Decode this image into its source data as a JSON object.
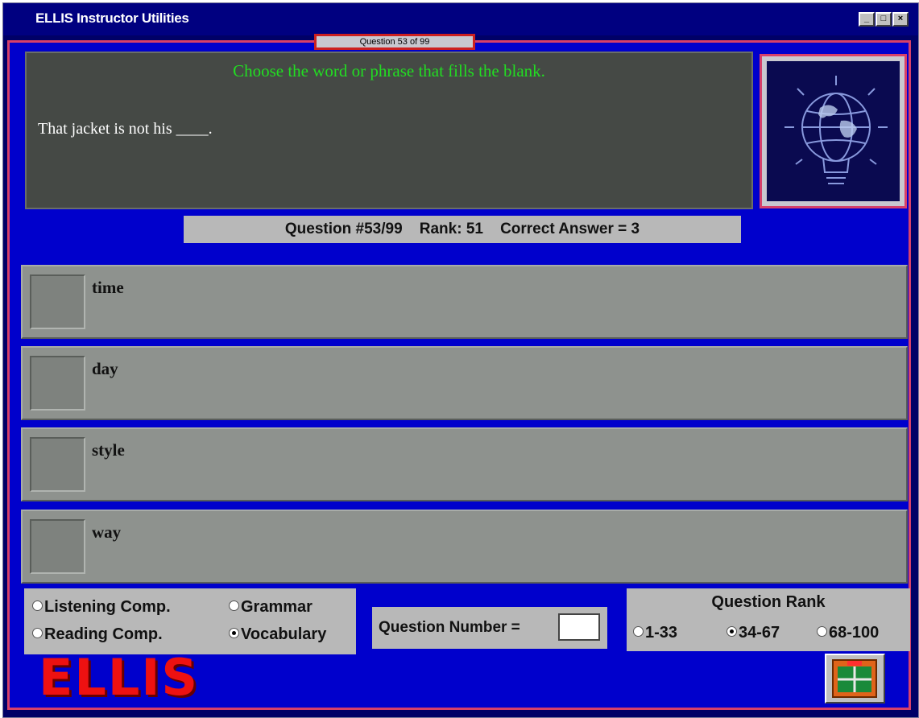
{
  "window": {
    "title": "ELLIS Instructor Utilities"
  },
  "question_tab": "Question 53 of 99",
  "question": {
    "instruction": "Choose the word or phrase that fills the blank.",
    "prompt": "That jacket is not his ____."
  },
  "info_bar": "Question #53/99    Rank: 51    Correct Answer = 3",
  "options": [
    {
      "label": "time"
    },
    {
      "label": "day"
    },
    {
      "label": "style"
    },
    {
      "label": "way"
    }
  ],
  "categories": [
    {
      "label": "Listening Comp.",
      "selected": false
    },
    {
      "label": "Grammar",
      "selected": false
    },
    {
      "label": "Reading Comp.",
      "selected": false
    },
    {
      "label": "Vocabulary",
      "selected": true
    }
  ],
  "question_number": {
    "label": "Question Number =",
    "value": ""
  },
  "question_rank": {
    "heading": "Question Rank",
    "options": [
      {
        "label": "1-33",
        "selected": false
      },
      {
        "label": "34-67",
        "selected": true
      },
      {
        "label": "68-100",
        "selected": false
      }
    ]
  },
  "logo_text": "ELLIS",
  "icons": {
    "picture": "globe-lightbulb-icon",
    "exit": "exit-door-icon"
  },
  "colors": {
    "window_bg": "#0000cc",
    "accent_border": "#d6406a",
    "instruction_text": "#22dd22",
    "logo": "#ee1111"
  }
}
